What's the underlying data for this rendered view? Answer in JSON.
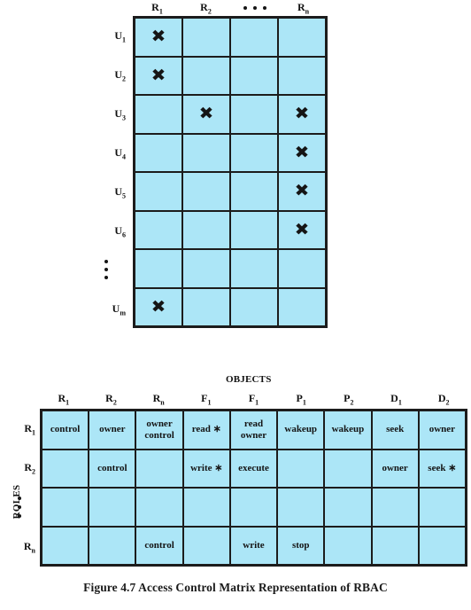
{
  "figure": {
    "caption": "Figure 4.7  Access Control Matrix Representation of RBAC"
  },
  "upper_matrix": {
    "name": "users-to-roles-matrix",
    "column_headers": [
      "R1",
      "R2",
      "• • •",
      "Rn"
    ],
    "column_header_display": [
      {
        "base": "R",
        "sub": "1"
      },
      {
        "base": "R",
        "sub": "2"
      },
      {
        "base": "dots",
        "sub": ""
      },
      {
        "base": "R",
        "sub": "n"
      }
    ],
    "row_headers": [
      "U1",
      "U2",
      "U3",
      "U4",
      "U5",
      "U6",
      "⋮",
      "Um"
    ],
    "row_header_display": [
      {
        "base": "U",
        "sub": "1"
      },
      {
        "base": "U",
        "sub": "2"
      },
      {
        "base": "U",
        "sub": "3"
      },
      {
        "base": "U",
        "sub": "4"
      },
      {
        "base": "U",
        "sub": "5"
      },
      {
        "base": "U",
        "sub": "6"
      },
      {
        "base": "dots",
        "sub": ""
      },
      {
        "base": "U",
        "sub": "m"
      }
    ],
    "mark_glyph": "✖",
    "cells": [
      [
        "x",
        "",
        "",
        ""
      ],
      [
        "x",
        "",
        "",
        ""
      ],
      [
        "",
        "x",
        "",
        "x"
      ],
      [
        "",
        "",
        "",
        "x"
      ],
      [
        "",
        "",
        "",
        "x"
      ],
      [
        "",
        "",
        "",
        "x"
      ],
      [
        "",
        "",
        "",
        ""
      ],
      [
        "x",
        "",
        "",
        ""
      ]
    ]
  },
  "lower_matrix": {
    "name": "roles-to-objects-matrix",
    "objects_label": "OBJECTS",
    "roles_label": "ROLES",
    "column_headers": [
      "R1",
      "R2",
      "Rn",
      "F1",
      "F1",
      "P1",
      "P2",
      "D1",
      "D2"
    ],
    "column_header_display": [
      {
        "base": "R",
        "sub": "1"
      },
      {
        "base": "R",
        "sub": "2"
      },
      {
        "base": "R",
        "sub": "n"
      },
      {
        "base": "F",
        "sub": "1"
      },
      {
        "base": "F",
        "sub": "1"
      },
      {
        "base": "P",
        "sub": "1"
      },
      {
        "base": "P",
        "sub": "2"
      },
      {
        "base": "D",
        "sub": "1"
      },
      {
        "base": "D",
        "sub": "2"
      }
    ],
    "row_headers": [
      "R1",
      "R2",
      "⋮",
      "Rn"
    ],
    "row_header_display": [
      {
        "base": "R",
        "sub": "1"
      },
      {
        "base": "R",
        "sub": "2"
      },
      {
        "base": "dots",
        "sub": ""
      },
      {
        "base": "R",
        "sub": "n"
      }
    ],
    "cells": [
      [
        "control",
        "owner",
        "owner\ncontrol",
        "read ∗",
        "read\nowner",
        "wakeup",
        "wakeup",
        "seek",
        "owner"
      ],
      [
        "",
        "control",
        "",
        "write ∗",
        "execute",
        "",
        "",
        "owner",
        "seek ∗"
      ],
      [
        "",
        "",
        "",
        "",
        "",
        "",
        "",
        "",
        ""
      ],
      [
        "",
        "",
        "control",
        "",
        "write",
        "stop",
        "",
        "",
        ""
      ]
    ]
  },
  "colors": {
    "cell_fill": "#ace6f7",
    "border": "#1c1c1c",
    "text": "#141414",
    "background": "#ffffff"
  }
}
